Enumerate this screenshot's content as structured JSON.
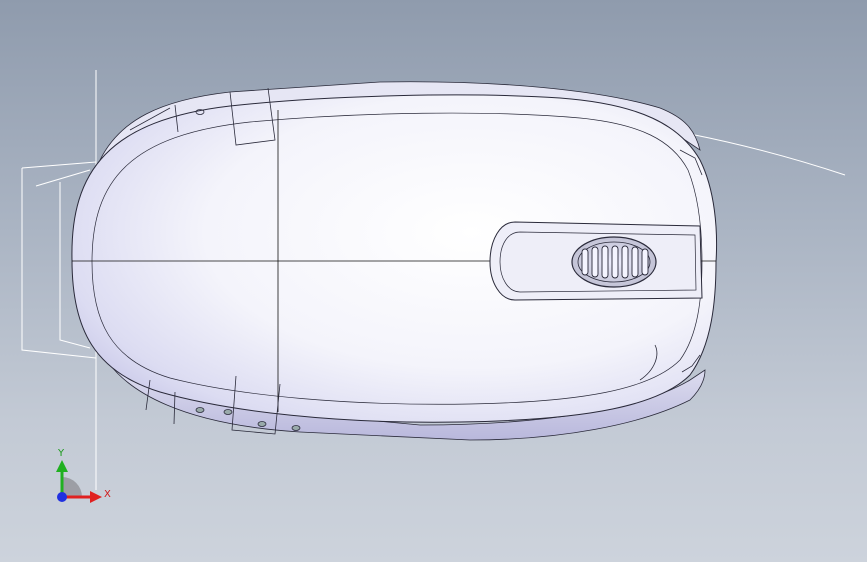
{
  "viewport": {
    "background_top": "#8f9bad",
    "background_bottom": "#cdd3dc"
  },
  "model": {
    "body_color": "#f4f4fb",
    "shade_color": "#c9c8ea",
    "edge_color": "#2a2a3a",
    "scroll_wheel_color": "#d8d8e4"
  },
  "triad": {
    "x_label": "X",
    "y_label": "Y",
    "x_color": "#e02020",
    "y_color": "#20b020",
    "z_color": "#2030e0"
  }
}
